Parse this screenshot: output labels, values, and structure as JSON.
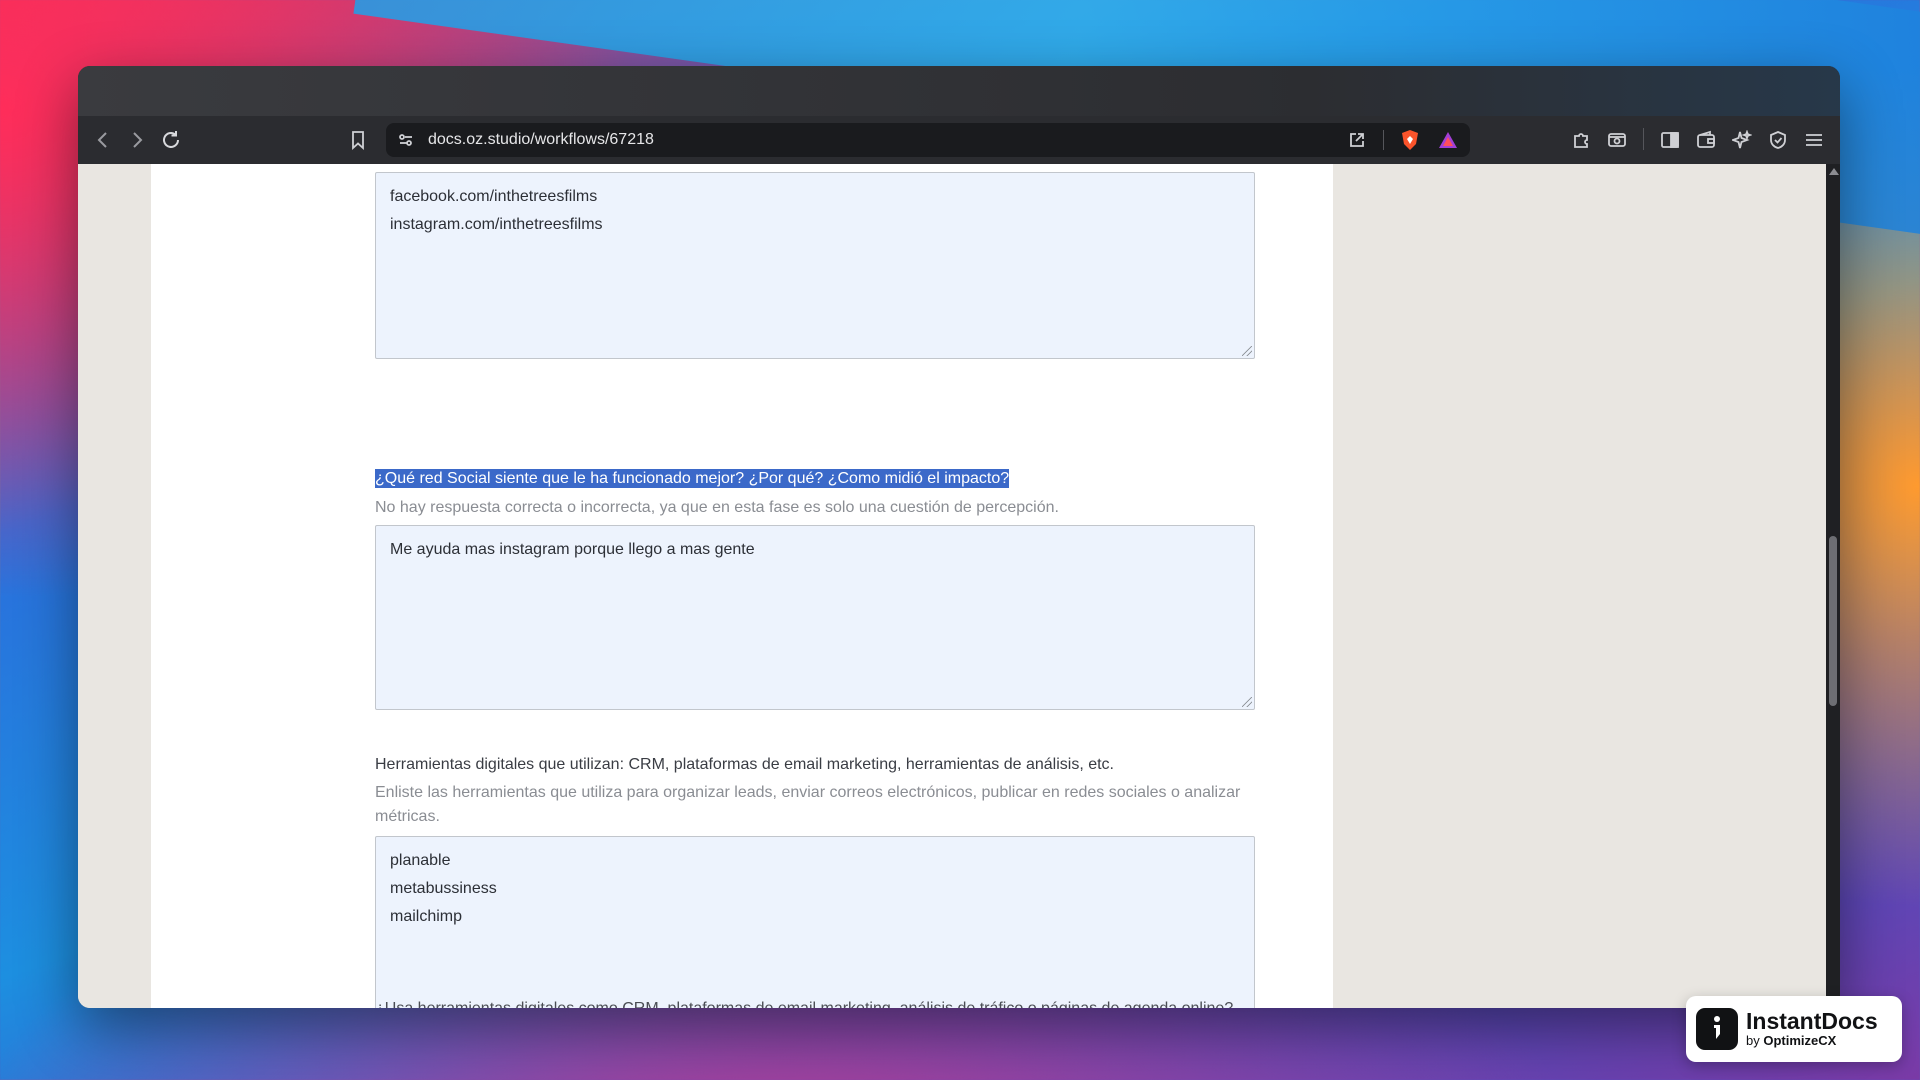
{
  "browser": {
    "url": "docs.oz.studio/workflows/67218"
  },
  "form": {
    "social_links": {
      "lines": [
        "facebook.com/inthetreesfilms",
        "instagram.com/inthetreesfilms"
      ]
    },
    "best_network": {
      "question": "¿Qué red Social siente que le ha funcionado mejor? ¿Por qué? ¿Como midió el impacto?",
      "hint": "No hay respuesta correcta o incorrecta, ya que en esta fase es solo una cuestión de percepción.",
      "answer": "Me ayuda mas instagram porque llego a mas gente"
    },
    "digital_tools": {
      "question": "Herramientas digitales que utilizan: CRM, plataformas de email marketing, herramientas de análisis, etc.",
      "hint": "Enliste las herramientas que utiliza para organizar leads, enviar correos electrónicos, publicar en redes sociales o analizar métricas.",
      "lines": [
        "planable",
        "metabussiness",
        "mailchimp"
      ]
    },
    "next_question_cut": "¿Usa herramientas digitales como CRM, plataformas de email marketing, análisis de tráfico o páginas de agenda online?"
  },
  "badge": {
    "title": "InstantDocs",
    "by": "by",
    "brand": "OptimizeCX"
  },
  "colors": {
    "selection": "#3b69c9",
    "field_bg": "#edf3fd",
    "sidebar_bg": "#e9e6e1"
  }
}
